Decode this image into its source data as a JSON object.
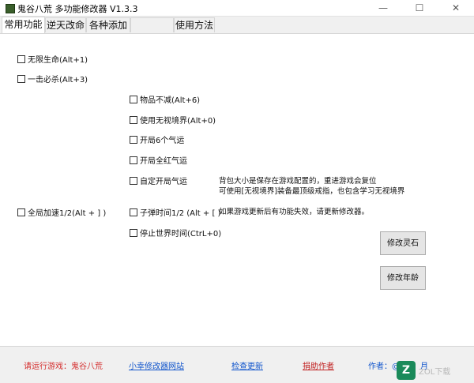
{
  "window": {
    "title": "鬼谷八荒 多功能修改器  V1.3.3",
    "minimize_glyph": "—",
    "maximize_glyph": "☐",
    "close_glyph": "✕"
  },
  "tabs": [
    {
      "label": "常用功能",
      "active": true
    },
    {
      "label": "逆天改命",
      "active": false
    },
    {
      "label": "各种添加",
      "active": false
    },
    {
      "label": "",
      "active": false
    },
    {
      "label": "使用方法",
      "active": false
    }
  ],
  "options": {
    "infinite_health": "无限生命(Alt+1)",
    "one_hit_kill": "一击必杀(Alt+3)",
    "items_no_decrease": "物品不减(Alt+6)",
    "use_ignore_realm": "使用无视境界(Alt+0)",
    "start_6_fortunes": "开局6个气运",
    "start_all_red_fortunes": "开局全红气运",
    "custom_start_fortunes": "自定开局气运",
    "global_speed": "全局加速1/2(Alt + ] )",
    "bullet_time": "子弹时间1/2 (Alt + [ )",
    "stop_world_time": "停止世界时间(CtrL+0)"
  },
  "notes": {
    "line1": "背包大小是保存在游戏配置的，重进游戏会复位",
    "line2": "可使用[无视境界]装备最顶级戒指，也包含学习无视境界",
    "line3": "如果游戏更新后有功能失效，请更新修改器。"
  },
  "buttons": {
    "modify_spirit_stone": "修改灵石",
    "modify_age": "修改年龄"
  },
  "footer": {
    "status": "请运行游戏：鬼谷八荒",
    "site_link": "小幸修改器网站",
    "check_update": "检查更新",
    "donate": "捐助作者",
    "author": "作者：@",
    "author_tail": "月"
  },
  "watermark": {
    "logo": "Z",
    "text": "ZOL下载"
  }
}
